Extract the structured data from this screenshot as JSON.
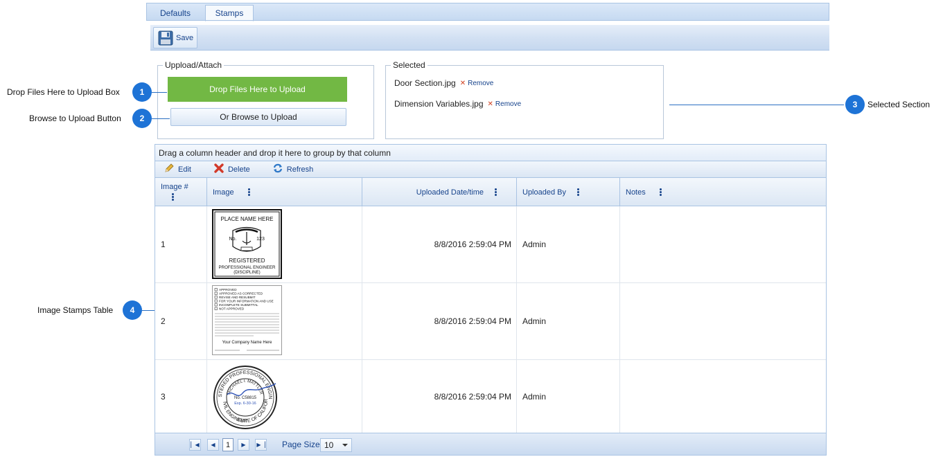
{
  "tabs": [
    {
      "label": "Defaults",
      "active": false
    },
    {
      "label": "Stamps",
      "active": true
    }
  ],
  "toolbar": {
    "save_label": "Save"
  },
  "upload": {
    "legend": "Uppload/Attach",
    "drop_label": "Drop Files Here to Upload",
    "browse_label": "Or Browse to Upload"
  },
  "selected": {
    "legend": "Selected",
    "files": [
      {
        "name": "Door Section.jpg",
        "remove": "Remove"
      },
      {
        "name": "Dimension Variables.jpg",
        "remove": "Remove"
      }
    ]
  },
  "callouts": [
    {
      "num": "1",
      "label": "Drop Files Here to Upload Box"
    },
    {
      "num": "2",
      "label": "Browse to Upload Button"
    },
    {
      "num": "3",
      "label": "Selected Section"
    },
    {
      "num": "4",
      "label": "Image Stamps Table"
    }
  ],
  "grid": {
    "group_panel": "Drag a column header and drop it here to group by that column",
    "toolbar": {
      "edit": "Edit",
      "delete": "Delete",
      "refresh": "Refresh"
    },
    "columns": [
      "Image #",
      "Image",
      "Uploaded Date/time",
      "Uploaded By",
      "Notes"
    ],
    "rows": [
      {
        "num": "1",
        "date": "8/8/2016 2:59:04 PM",
        "by": "Admin",
        "notes": ""
      },
      {
        "num": "2",
        "date": "8/8/2016 2:59:04 PM",
        "by": "Admin",
        "notes": ""
      },
      {
        "num": "3",
        "date": "8/8/2016 2:59:04 PM",
        "by": "Admin",
        "notes": ""
      }
    ],
    "stamp1": {
      "line1": "PLACE NAME HERE",
      "no": "No.",
      "num": "123",
      "line2": "REGISTERED",
      "line3": "PROFESSIONAL ENGINEER",
      "line4": "(DISCIPLINE)"
    },
    "stamp2": {
      "options": [
        "APPROVED",
        "APPROVED AS CORRECTED",
        "REVISE AND RESUBMIT",
        "FOR YOUR INFORMATION AND USE",
        "INCOMPLETE SUBMITTAL",
        "NOT APPROVED"
      ],
      "company": "Your Company Name Here"
    },
    "stamp3": {
      "outer_top": "REGISTERED PROFESSIONAL ENGINEER",
      "name": "MICHAEL I. MATTLER",
      "no": "No. C58815",
      "exp": "Exp. 6-30-16",
      "bottom1": "CIVIL ENGINEER",
      "bottom2": "STATE OF CALIFORNIA"
    },
    "pager": {
      "current_page": "1",
      "page_size_label": "Page Size",
      "page_size": "10"
    }
  }
}
